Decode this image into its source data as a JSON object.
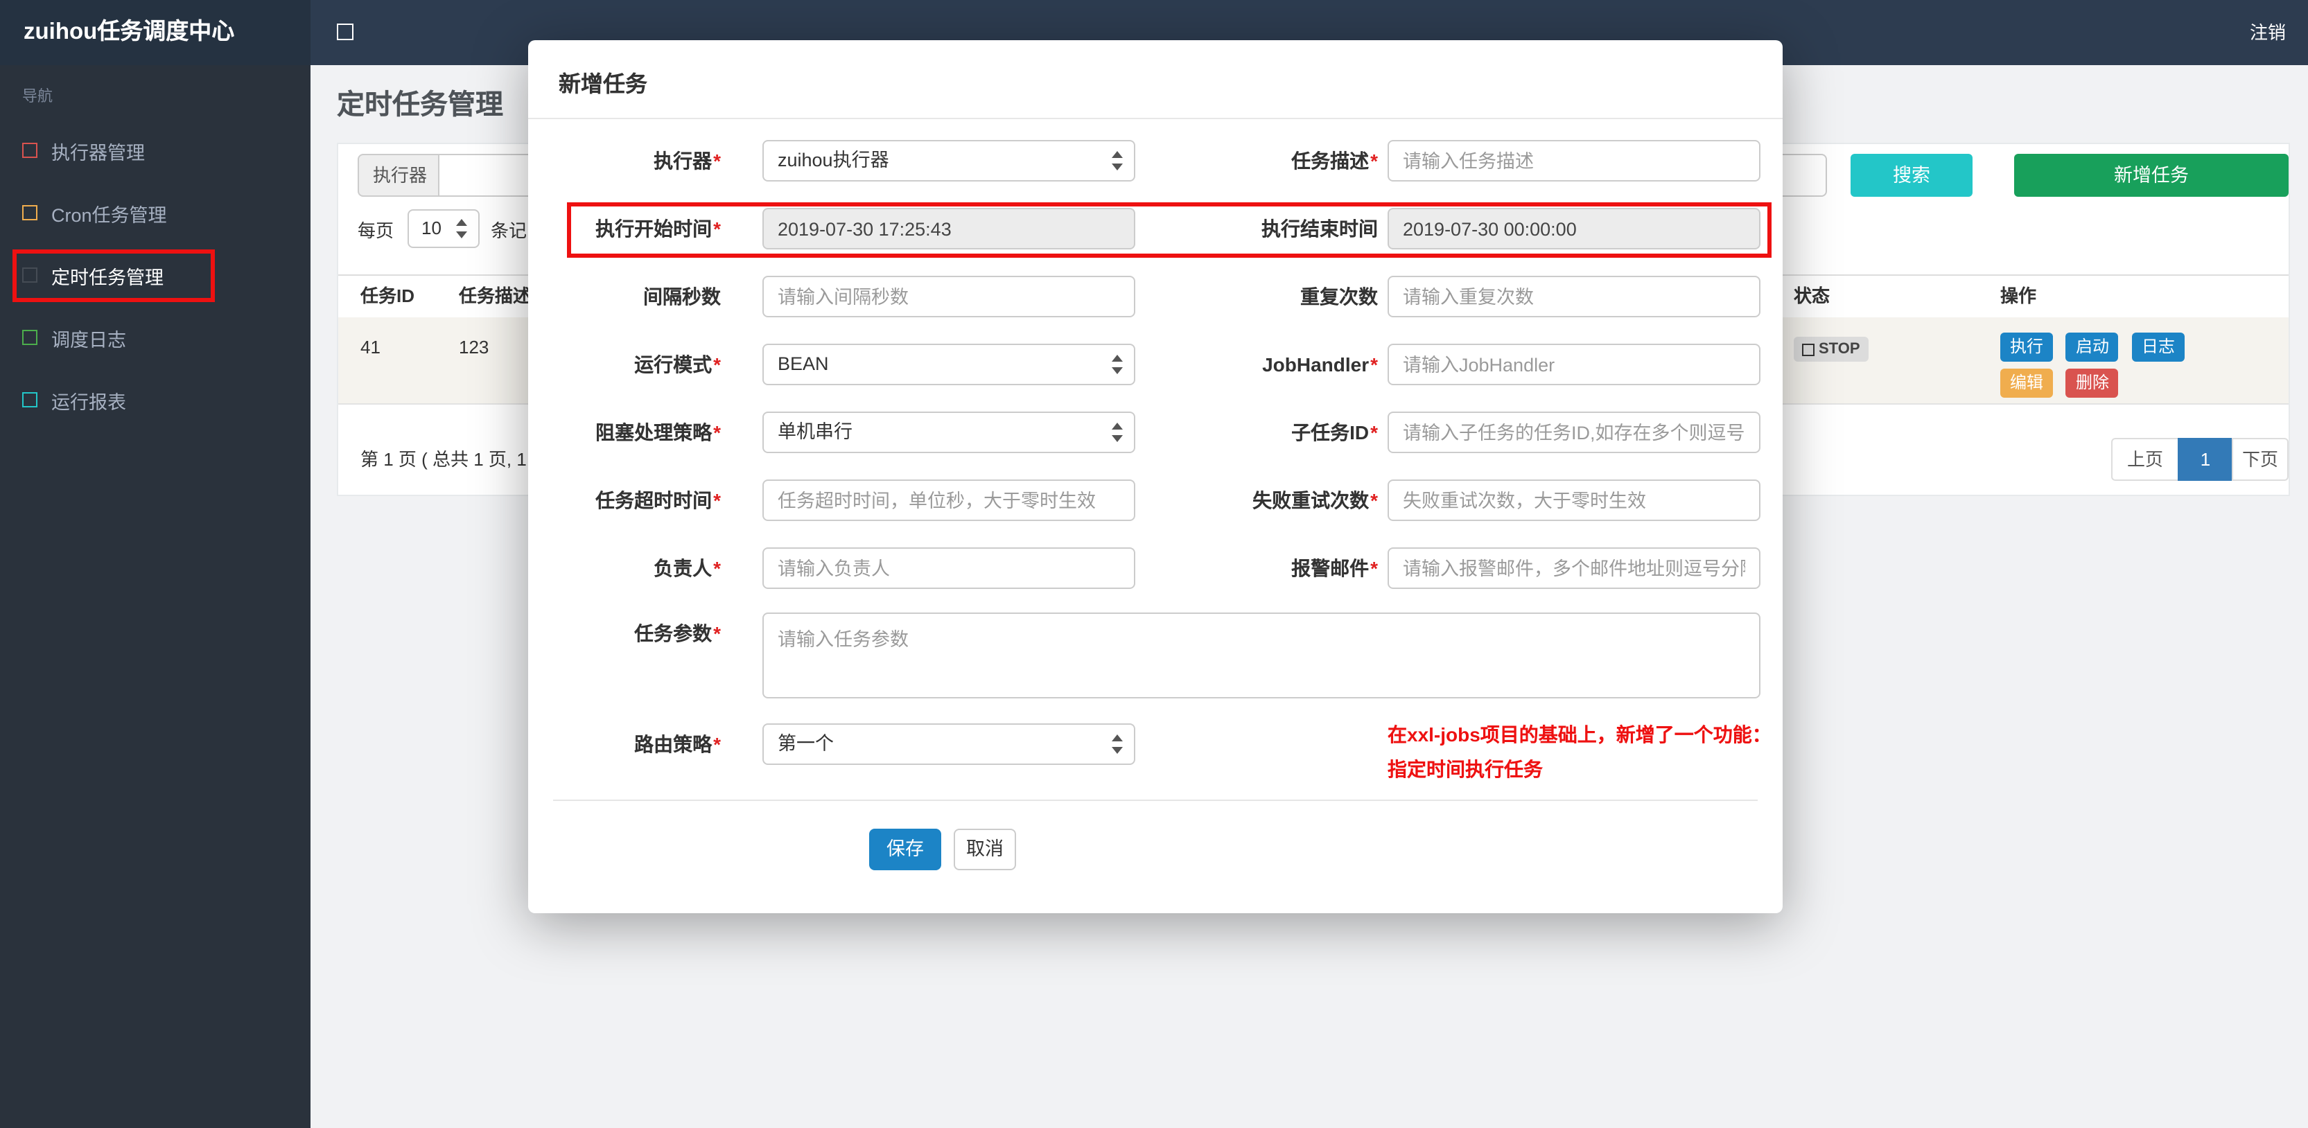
{
  "topbar": {
    "brand": "zuihou任务调度中心",
    "logout": "注销"
  },
  "sidebar": {
    "nav_header": "导航",
    "items": [
      {
        "label": "执行器管理",
        "icon": "square-red"
      },
      {
        "label": "Cron任务管理",
        "icon": "square-orange"
      },
      {
        "label": "定时任务管理",
        "icon": "square-dark",
        "active": true
      },
      {
        "label": "调度日志",
        "icon": "square-green"
      },
      {
        "label": "运行报表",
        "icon": "square-teal"
      }
    ]
  },
  "page": {
    "title": "定时任务管理"
  },
  "toolbar": {
    "executor_addon": "执行器",
    "search": "搜索",
    "add_job": "新增任务",
    "per_page_label": "每页",
    "per_page_value": "10",
    "records_suffix": "条记"
  },
  "table": {
    "headers": {
      "job_id": "任务ID",
      "job_desc": "任务描述",
      "status": "状态",
      "actions": "操作"
    },
    "row": {
      "job_id": "41",
      "job_desc": "123",
      "status": "STOP",
      "op_execute": "执行",
      "op_start": "启动",
      "op_log": "日志",
      "op_edit": "编辑",
      "op_delete": "删除"
    }
  },
  "pagination": {
    "summary": "第 1 页 ( 总共 1 页, 1",
    "prev": "上页",
    "current": "1",
    "next": "下页"
  },
  "modal": {
    "title": "新增任务",
    "required_marker": "*",
    "executor": {
      "label": "执行器",
      "value": "zuihou执行器"
    },
    "job_desc": {
      "label": "任务描述",
      "placeholder": "请输入任务描述"
    },
    "start_time": {
      "label": "执行开始时间",
      "value": "2019-07-30 17:25:43"
    },
    "end_time": {
      "label": "执行结束时间",
      "value": "2019-07-30 00:00:00"
    },
    "interval": {
      "label": "间隔秒数",
      "placeholder": "请输入间隔秒数"
    },
    "repeat": {
      "label": "重复次数",
      "placeholder": "请输入重复次数"
    },
    "run_mode": {
      "label": "运行模式",
      "value": "BEAN"
    },
    "job_handler": {
      "label": "JobHandler",
      "placeholder": "请输入JobHandler"
    },
    "block_strategy": {
      "label": "阻塞处理策略",
      "value": "单机串行"
    },
    "child_job_id": {
      "label": "子任务ID",
      "placeholder": "请输入子任务的任务ID,如存在多个则逗号分隔"
    },
    "timeout": {
      "label": "任务超时时间",
      "placeholder": "任务超时时间，单位秒，大于零时生效"
    },
    "fail_retry": {
      "label": "失败重试次数",
      "placeholder": "失败重试次数，大于零时生效"
    },
    "owner": {
      "label": "负责人",
      "placeholder": "请输入负责人"
    },
    "alarm_email": {
      "label": "报警邮件",
      "placeholder": "请输入报警邮件，多个邮件地址则逗号分隔"
    },
    "job_param": {
      "label": "任务参数",
      "placeholder": "请输入任务参数"
    },
    "route_strategy": {
      "label": "路由策略",
      "value": "第一个"
    },
    "note_line1": "在xxl-jobs项目的基础上，新增了一个功能：",
    "note_line2": "指定时间执行任务",
    "save": "保存",
    "cancel": "取消"
  },
  "colors": {
    "topbar": "#2d3c50",
    "sidebar": "#2a323c",
    "search_button": "#23c6c8",
    "add_button": "#18a05b",
    "save_button": "#1c84c6",
    "warning": "#f0ad4e",
    "danger": "#d9534f",
    "pagination_active": "#337ab7",
    "annotation": "#ee1111"
  }
}
